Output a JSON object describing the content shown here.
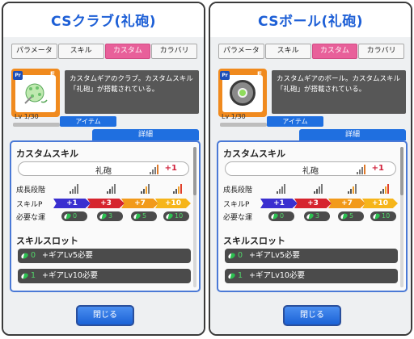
{
  "tabs": [
    "パラメータ",
    "スキル",
    "カスタム",
    "カラバリ"
  ],
  "active_tab_index": 2,
  "panels": [
    {
      "title": "CSクラブ(礼砲)",
      "badge_type": "Pr",
      "rarity": "E",
      "level": "Lv 1/30",
      "description": "カスタムギアのクラブ。カスタムスキル「礼砲」が搭載されている。",
      "item_button": "アイテム",
      "detail_tab": "詳細",
      "custom_skill_label": "カスタムスキル",
      "skill_name": "礼砲",
      "skill_bonus": "+1",
      "growth_label": "成長段階",
      "skillp_label": "スキルP",
      "skillp_values": [
        "+1",
        "+3",
        "+7",
        "+10"
      ],
      "fortune_label": "必要な運",
      "fortune_values": [
        "0",
        "3",
        "5",
        "10"
      ],
      "slot_label": "スキルスロット",
      "slots": [
        {
          "num": "0",
          "text": "+ギアLv5必要"
        },
        {
          "num": "1",
          "text": "+ギアLv10必要"
        }
      ],
      "close_button": "閉じる"
    },
    {
      "title": "CSボール(礼砲)",
      "badge_type": "Pr",
      "rarity": "E",
      "level": "Lv 1/30",
      "description": "カスタムギアのボール。カスタムスキル「礼砲」が搭載されている。",
      "item_button": "アイテム",
      "detail_tab": "詳細",
      "custom_skill_label": "カスタムスキル",
      "skill_name": "礼砲",
      "skill_bonus": "+1",
      "growth_label": "成長段階",
      "skillp_label": "スキルP",
      "skillp_values": [
        "+1",
        "+3",
        "+7",
        "+10"
      ],
      "fortune_label": "必要な運",
      "fortune_values": [
        "0",
        "3",
        "5",
        "10"
      ],
      "slot_label": "スキルスロット",
      "slots": [
        {
          "num": "0",
          "text": "+ギアLv5必要"
        },
        {
          "num": "1",
          "text": "+ギアLv10必要"
        }
      ],
      "close_button": "閉じる"
    }
  ],
  "colors": {
    "title_blue": "#1d5fd6",
    "tab_active": "#e8609a",
    "rarity_orange": "#f08a1e",
    "arrow_colors": [
      "#3a2fd0",
      "#d6242e",
      "#f29a1a",
      "#f6b51a"
    ]
  }
}
